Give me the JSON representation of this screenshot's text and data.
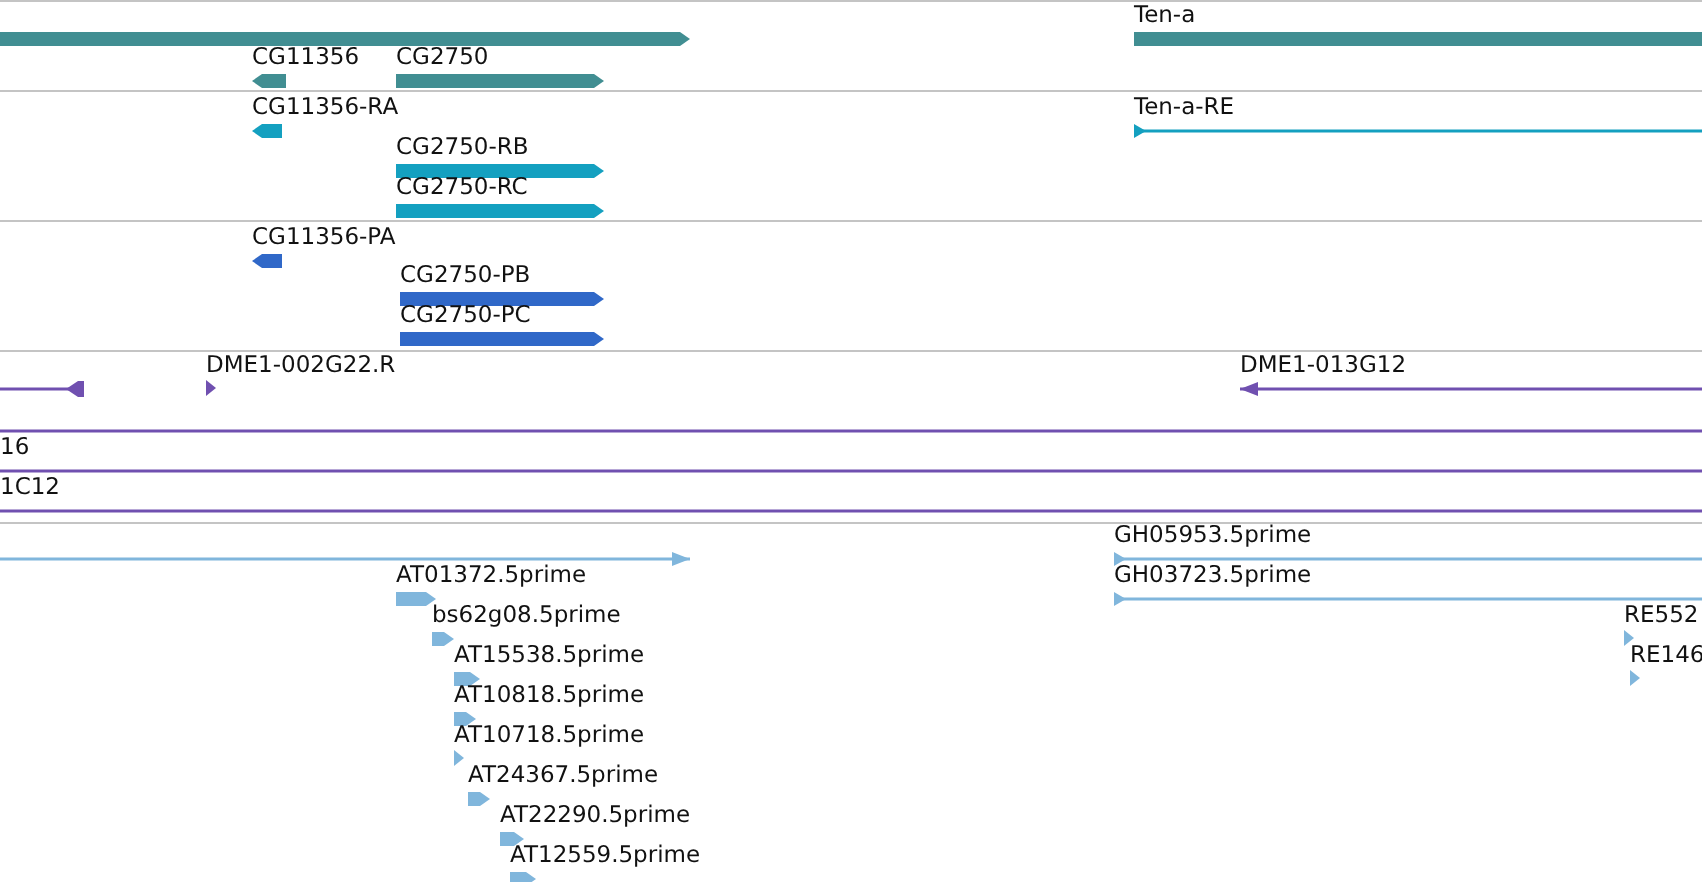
{
  "tracks": [
    {
      "color": "#418e92",
      "features": [
        {
          "kind": "bar",
          "reverse": false
        },
        {
          "kind": "bar",
          "reverse": true,
          "label": "CG11356"
        },
        {
          "kind": "bar",
          "reverse": false,
          "label": "CG2750"
        },
        {
          "kind": "bar",
          "reverse": false,
          "label": "Ten-a"
        }
      ]
    },
    {
      "color": "#14a0c0",
      "features": [
        {
          "kind": "bar",
          "reverse": true,
          "label": "CG11356-RA"
        },
        {
          "kind": "bar",
          "reverse": false,
          "label": "CG2750-RB"
        },
        {
          "kind": "bar",
          "reverse": false,
          "label": "CG2750-RC"
        },
        {
          "kind": "line",
          "reverse": false,
          "label": "Ten-a-RE"
        }
      ]
    },
    {
      "color": "#3068c8",
      "features": [
        {
          "kind": "bar",
          "reverse": true,
          "label": "CG11356-PA"
        },
        {
          "kind": "bar",
          "reverse": false,
          "label": "CG2750-PB"
        },
        {
          "kind": "bar",
          "reverse": false,
          "label": "CG2750-PC"
        }
      ]
    },
    {
      "color": "#7050b0",
      "features": [
        {
          "kind": "line",
          "reverse": true
        },
        {
          "kind": "tick",
          "reverse": false,
          "label": "DME1-002G22.R"
        },
        {
          "kind": "line",
          "reverse": true,
          "label": "DME1-013G12"
        },
        {
          "kind": "span"
        },
        {
          "kind": "span",
          "label": "16"
        },
        {
          "kind": "span",
          "label": "1C12"
        }
      ]
    },
    {
      "color": "#80b6dc",
      "features": [
        {
          "kind": "line",
          "reverse": false
        },
        {
          "kind": "bar",
          "reverse": false,
          "label": "AT01372.5prime"
        },
        {
          "kind": "bar",
          "reverse": false,
          "label": "bs62g08.5prime"
        },
        {
          "kind": "bar",
          "reverse": false,
          "label": "AT15538.5prime"
        },
        {
          "kind": "bar",
          "reverse": false,
          "label": "AT10818.5prime"
        },
        {
          "kind": "tick",
          "reverse": false,
          "label": "AT10718.5prime"
        },
        {
          "kind": "bar",
          "reverse": false,
          "label": "AT24367.5prime"
        },
        {
          "kind": "bar",
          "reverse": false,
          "label": "AT22290.5prime"
        },
        {
          "kind": "bar",
          "reverse": false,
          "label": "AT12559.5prime"
        },
        {
          "kind": "line",
          "reverse": false,
          "label": "GH05953.5prime"
        },
        {
          "kind": "line",
          "reverse": false,
          "label": "GH03723.5prime"
        },
        {
          "kind": "tick",
          "reverse": false,
          "label": "RE552"
        },
        {
          "kind": "tick",
          "reverse": false,
          "label": "RE146"
        }
      ]
    }
  ]
}
